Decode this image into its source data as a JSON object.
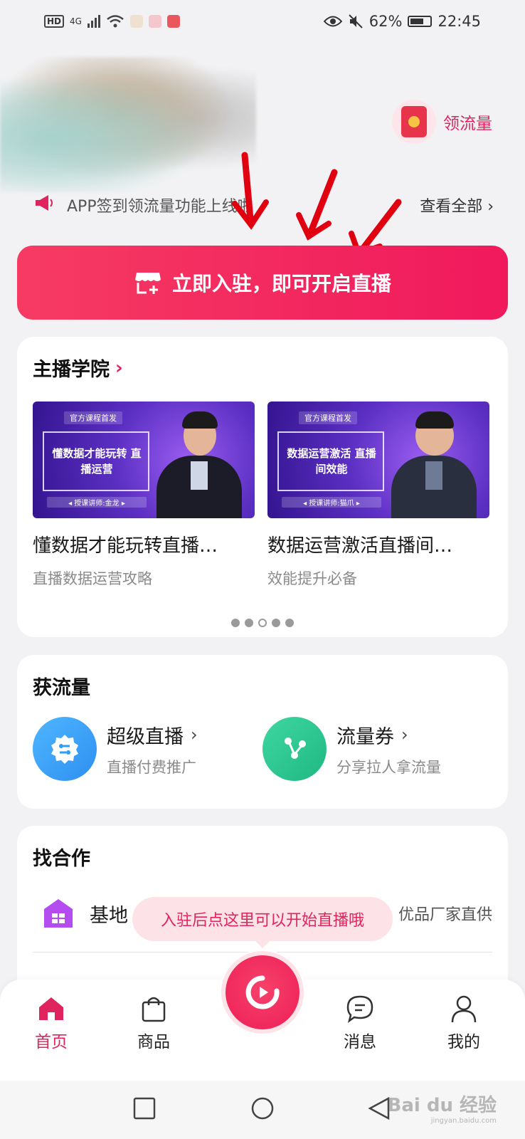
{
  "status_bar": {
    "hd": "HD",
    "network": "4G",
    "battery": "62%",
    "time": "22:45"
  },
  "header": {
    "claim_traffic_label": "领流量"
  },
  "notice": {
    "text": "APP签到领流量功能上线啦",
    "view_all": "查看全部 ›"
  },
  "cta": {
    "label": "立即入驻，即可开启直播"
  },
  "academy": {
    "title": "主播学院",
    "chevron": "›",
    "courses": [
      {
        "tag": "官方课程首发",
        "thumb_title": "懂数据才能玩转 直播运营",
        "lecturer": "◂ 授课讲师:金龙 ▸",
        "title": "懂数据才能玩转直播…",
        "subtitle": "直播数据运营攻略"
      },
      {
        "tag": "官方课程首发",
        "thumb_title": "数据运营激活 直播间效能",
        "lecturer": "◂ 授课讲师:猫爪 ▸",
        "title": "数据运营激活直播间…",
        "subtitle": "效能提升必备"
      }
    ],
    "pager": {
      "count": 5,
      "active_index": 2
    }
  },
  "traffic": {
    "title": "获流量",
    "tools": [
      {
        "name": "超级直播",
        "chevron": "›",
        "subtitle": "直播付费推广",
        "icon": "gear-connect-icon",
        "color": "#2e9df5"
      },
      {
        "name": "流量券",
        "chevron": "›",
        "subtitle": "分享拉人拿流量",
        "icon": "share-nodes-icon",
        "color": "#27c48f"
      }
    ]
  },
  "cooperation": {
    "title": "找合作",
    "row_name": "基地",
    "row_right": "优品厂家直供"
  },
  "tooltip": {
    "text": "入驻后点这里可以开始直播哦"
  },
  "tabbar": {
    "items": [
      {
        "label": "首页",
        "icon": "home-icon",
        "active": true
      },
      {
        "label": "商品",
        "icon": "shopping-bag-icon",
        "active": false
      },
      {
        "label": "",
        "icon": "live-camera-icon",
        "active": false
      },
      {
        "label": "消息",
        "icon": "chat-bubble-icon",
        "active": false
      },
      {
        "label": "我的",
        "icon": "user-icon",
        "active": false
      }
    ]
  },
  "watermark": {
    "brand": "Bai du 经验",
    "url": "jingyan.baidu.com"
  },
  "colors": {
    "accent": "#e0245e",
    "cta_start": "#f63b63",
    "cta_end": "#f0195c"
  }
}
